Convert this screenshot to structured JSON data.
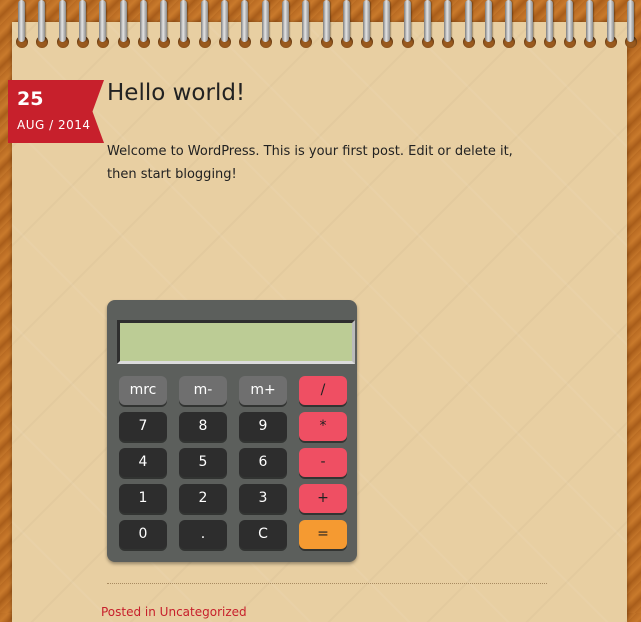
{
  "post": {
    "day": "25",
    "month_year": "AUG / 2014",
    "title": "Hello world!",
    "body": "Welcome to WordPress. This is your first post. Edit or delete it, then start blogging!"
  },
  "calculator": {
    "display": "",
    "keys": [
      [
        {
          "label": "mrc",
          "kind": "mem"
        },
        {
          "label": "m-",
          "kind": "mem"
        },
        {
          "label": "m+",
          "kind": "mem"
        },
        {
          "label": "/",
          "kind": "op"
        }
      ],
      [
        {
          "label": "7",
          "kind": "num"
        },
        {
          "label": "8",
          "kind": "num"
        },
        {
          "label": "9",
          "kind": "num"
        },
        {
          "label": "*",
          "kind": "op"
        }
      ],
      [
        {
          "label": "4",
          "kind": "num"
        },
        {
          "label": "5",
          "kind": "num"
        },
        {
          "label": "6",
          "kind": "num"
        },
        {
          "label": "-",
          "kind": "op"
        }
      ],
      [
        {
          "label": "1",
          "kind": "num"
        },
        {
          "label": "2",
          "kind": "num"
        },
        {
          "label": "3",
          "kind": "num"
        },
        {
          "label": "+",
          "kind": "op"
        }
      ],
      [
        {
          "label": "0",
          "kind": "num"
        },
        {
          "label": ".",
          "kind": "num"
        },
        {
          "label": "C",
          "kind": "num"
        },
        {
          "label": "=",
          "kind": "eq"
        }
      ]
    ]
  },
  "footer": {
    "link": "Posted in Uncategorized"
  },
  "colors": {
    "ribbon": "#c7202c",
    "paper": "#e8cfa2",
    "calc_body": "#5c5f5c",
    "screen": "#bccc95",
    "op_key": "#ef4f63",
    "eq_key": "#f59a31"
  }
}
